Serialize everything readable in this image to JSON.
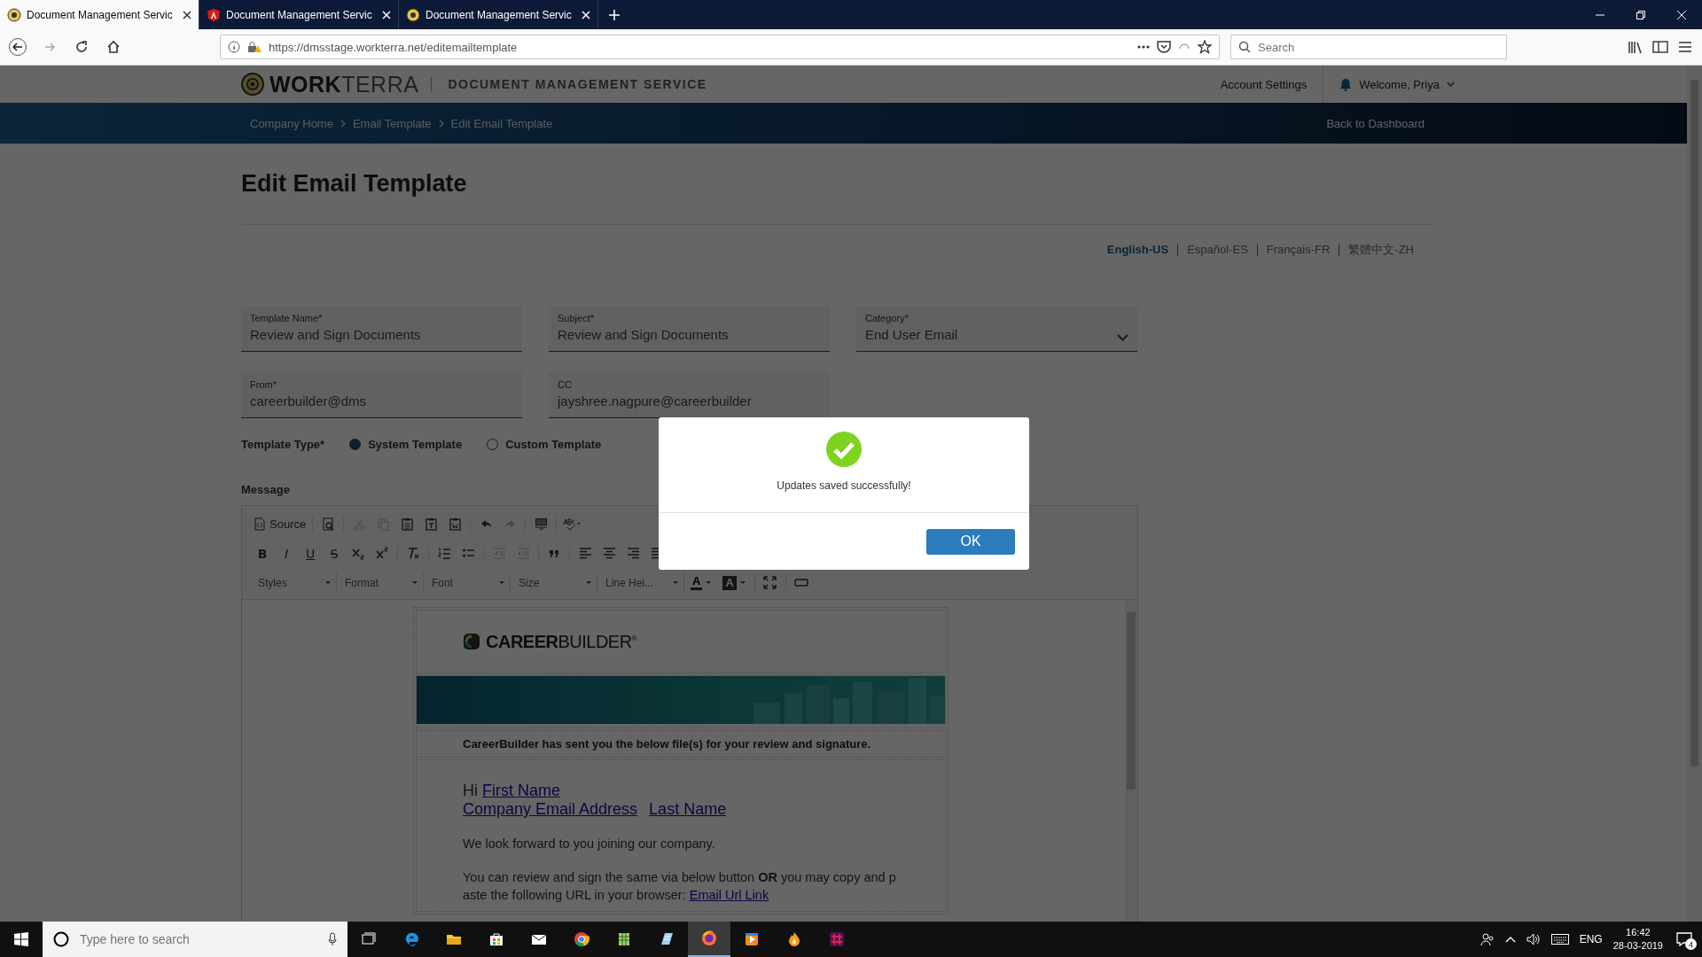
{
  "browser": {
    "tabs": [
      {
        "title": "Document Management Servic",
        "selected": true,
        "kind": "site"
      },
      {
        "title": "Document Management Servic",
        "selected": false,
        "kind": "angular"
      },
      {
        "title": "Document Management Servic",
        "selected": false,
        "kind": "site"
      }
    ],
    "url": "https://dmsstage.workterra.net/editemailtemplate",
    "search_placeholder": "Search"
  },
  "header": {
    "logo_bold": "WORK",
    "logo_light": "TERRA",
    "app_title": "DOCUMENT MANAGEMENT SERVICE",
    "account_settings": "Account Settings",
    "welcome": "Welcome, Priya"
  },
  "breadcrumbs": [
    "Company Home",
    "Email Template",
    "Edit Email Template"
  ],
  "back_link": "Back to Dashboard",
  "page_title": "Edit Email Template",
  "languages": [
    {
      "label": "English-US",
      "selected": true
    },
    {
      "label": "Español-ES",
      "selected": false
    },
    {
      "label": "Français-FR",
      "selected": false
    },
    {
      "label": "繁體中文-ZH",
      "selected": false
    }
  ],
  "fields": [
    {
      "label": "Template Name*",
      "value": "Review and Sign Documents",
      "kind": "text"
    },
    {
      "label": "Subject*",
      "value": "Review and Sign Documents",
      "kind": "text"
    },
    {
      "label": "Category*",
      "value": "End User Email",
      "kind": "select"
    },
    {
      "label": "From*",
      "value": "careerbuilder@dms",
      "kind": "text"
    },
    {
      "label": "CC",
      "value": "jayshree.nagpure@careerbuilder",
      "kind": "text"
    }
  ],
  "template_type": {
    "label": "Template Type*",
    "options": [
      {
        "label": "System Template",
        "selected": true
      },
      {
        "label": "Custom Template",
        "selected": false
      }
    ]
  },
  "message_label": "Message",
  "toolbar": [
    [
      {
        "kind": "button",
        "label": "Source"
      },
      {
        "kind": "sep"
      },
      {
        "kind": "icon",
        "disabled": false
      },
      {
        "kind": "sep"
      },
      {
        "kind": "icon",
        "disabled": true
      },
      {
        "kind": "icon",
        "disabled": true
      },
      {
        "kind": "icon",
        "disabled": false
      },
      {
        "kind": "icon",
        "disabled": false
      },
      {
        "kind": "icon",
        "disabled": false
      },
      {
        "kind": "sep"
      },
      {
        "kind": "icon",
        "disabled": false
      },
      {
        "kind": "icon",
        "disabled": true
      },
      {
        "kind": "sep"
      },
      {
        "kind": "icon",
        "disabled": false
      },
      {
        "kind": "sep"
      },
      {
        "kind": "icon",
        "disabled": false
      }
    ],
    [
      {
        "kind": "bold",
        "label": "B"
      },
      {
        "kind": "italic",
        "label": "I"
      },
      {
        "kind": "underline",
        "label": "U"
      },
      {
        "kind": "strike",
        "label": "S"
      },
      {
        "kind": "icon",
        "disabled": false
      },
      {
        "kind": "icon",
        "disabled": false
      },
      {
        "kind": "sep"
      },
      {
        "kind": "icon",
        "disabled": false
      },
      {
        "kind": "sep"
      },
      {
        "kind": "icon",
        "disabled": false
      },
      {
        "kind": "icon",
        "disabled": false
      },
      {
        "kind": "sep"
      },
      {
        "kind": "icon",
        "disabled": true
      },
      {
        "kind": "icon",
        "disabled": true
      },
      {
        "kind": "sep"
      },
      {
        "kind": "icon",
        "disabled": false
      },
      {
        "kind": "sep"
      },
      {
        "kind": "icon",
        "disabled": false
      },
      {
        "kind": "icon",
        "disabled": false
      },
      {
        "kind": "icon",
        "disabled": false
      },
      {
        "kind": "icon",
        "disabled": false
      }
    ],
    [
      {
        "kind": "combo",
        "label": "Styles"
      },
      {
        "kind": "combo",
        "label": "Format"
      },
      {
        "kind": "combo",
        "label": "Font"
      },
      {
        "kind": "combo",
        "label": "Size"
      },
      {
        "kind": "combo",
        "label": "Line Hei..."
      },
      {
        "kind": "text-color",
        "label": "A"
      },
      {
        "kind": "background-color",
        "label": "A"
      },
      {
        "kind": "sep"
      },
      {
        "kind": "icon",
        "disabled": false
      },
      {
        "kind": "sep"
      },
      {
        "kind": "icon",
        "disabled": false
      }
    ]
  ],
  "email": {
    "logo": "**CAREER**BUILDER$^{®}$",
    "intro": "CareerBuilder has sent you the below file(s) for your review and signature.",
    "greeting": "Hi",
    "first_name": "First Name",
    "company_email": "Company Email Address",
    "last_name": "Last Name",
    "paragraph_1": "We look forward to you joining our company.",
    "paragraph_2": "You can review and sign the same via below button **OR** you may copy and p aste the following URL in your browser:",
    "url_link": "Email Url Link"
  },
  "dialog": {
    "message": "Updates saved successfully!",
    "ok": "OK"
  },
  "taskbar": {
    "search_placeholder": "Type here to search",
    "apps": [
      {
        "active": false
      },
      {
        "active": false
      },
      {
        "active": false
      },
      {
        "active": false
      },
      {
        "active": false
      },
      {
        "active": false
      },
      {
        "active": false
      },
      {
        "active": false
      },
      {
        "active": true
      },
      {
        "active": false
      },
      {
        "active": false
      },
      {
        "active": false
      }
    ],
    "language": "ENG",
    "time": "16:42",
    "date": "28-03-2019",
    "notifications": "4"
  }
}
